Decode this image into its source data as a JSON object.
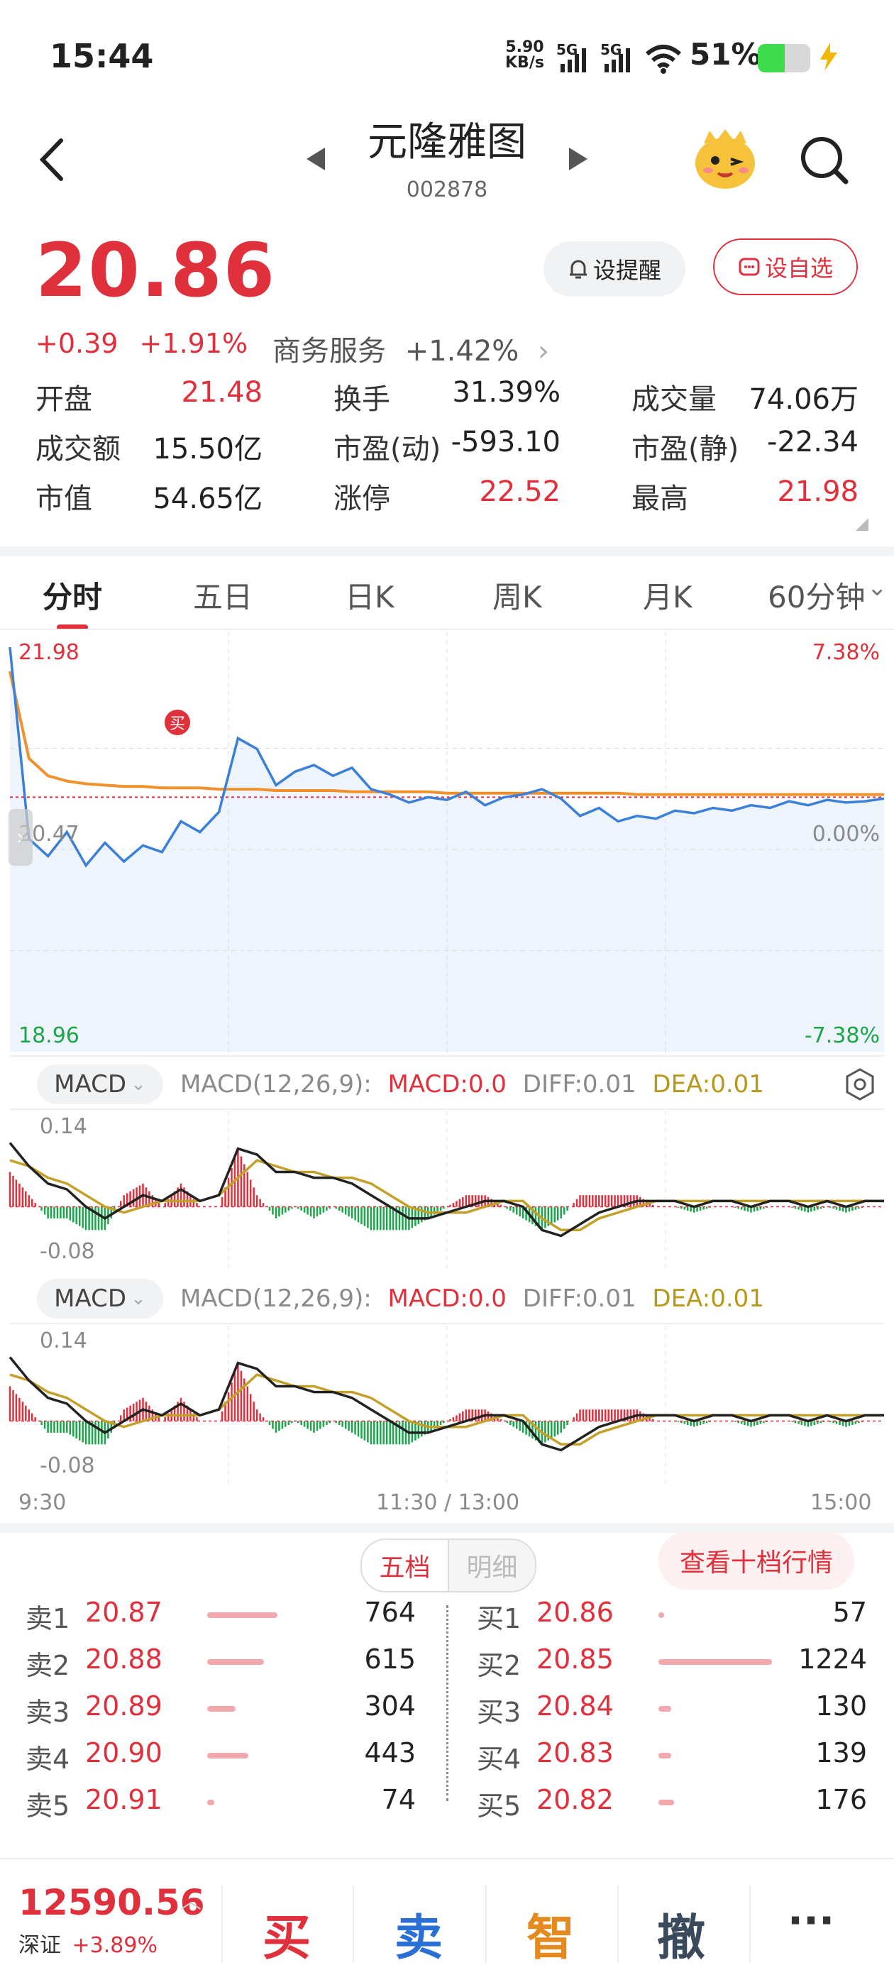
{
  "status": {
    "time": "15:44",
    "net_speed_top": "5.90",
    "net_speed_bottom": "KB/s",
    "sig1": "5G",
    "sig2": "5G",
    "battery": "51%"
  },
  "header": {
    "name": "元隆雅图",
    "code": "002878"
  },
  "quote": {
    "price": "20.86",
    "change": "+0.39",
    "change_pct": "+1.91%",
    "sector": "商务服务",
    "sector_pct": "+1.42%",
    "alert_label": "设提醒",
    "watch_label": "设自选"
  },
  "stats": [
    [
      {
        "label": "开盘",
        "value": "21.48",
        "color": "red"
      },
      {
        "label": "换手",
        "value": "31.39%",
        "color": "dark"
      },
      {
        "label": "成交量",
        "value": "74.06万",
        "color": "dark"
      }
    ],
    [
      {
        "label": "成交额",
        "value": "15.50亿",
        "color": "dark"
      },
      {
        "label": "市盈(动)",
        "value": "-593.10",
        "color": "dark"
      },
      {
        "label": "市盈(静)",
        "value": "-22.34",
        "color": "dark"
      }
    ],
    [
      {
        "label": "市值",
        "value": "54.65亿",
        "color": "dark"
      },
      {
        "label": "涨停",
        "value": "22.52",
        "color": "red"
      },
      {
        "label": "最高",
        "value": "21.98",
        "color": "red"
      }
    ]
  ],
  "tabs": [
    "分时",
    "五日",
    "日K",
    "周K",
    "月K",
    "60分钟"
  ],
  "chart_data": {
    "type": "line",
    "y_top": "21.98",
    "y_mid": "20.47",
    "y_bottom": "18.96",
    "pct_top": "7.38%",
    "pct_mid": "0.00%",
    "pct_bottom": "-7.38%",
    "buy_marker": "买",
    "x_labels": [
      "9:30",
      "11:30 / 13:00",
      "15:00"
    ],
    "price_series": [
      21.98,
      20.55,
      20.42,
      20.6,
      20.35,
      20.52,
      20.38,
      20.5,
      20.45,
      20.68,
      20.6,
      20.75,
      21.3,
      21.22,
      20.95,
      21.05,
      21.1,
      21.02,
      21.08,
      20.92,
      20.88,
      20.82,
      20.86,
      20.84,
      20.9,
      20.8,
      20.86,
      20.88,
      20.92,
      20.85,
      20.72,
      20.78,
      20.68,
      20.72,
      20.7,
      20.76,
      20.74,
      20.78,
      20.76,
      20.8,
      20.78,
      20.83,
      20.8,
      20.84,
      20.82,
      20.83,
      20.85
    ],
    "avg_series": [
      21.8,
      21.15,
      21.02,
      20.98,
      20.96,
      20.95,
      20.94,
      20.94,
      20.93,
      20.93,
      20.93,
      20.92,
      20.92,
      20.92,
      20.91,
      20.91,
      20.91,
      20.91,
      20.9,
      20.9,
      20.9,
      20.9,
      20.9,
      20.89,
      20.89,
      20.89,
      20.89,
      20.89,
      20.89,
      20.89,
      20.89,
      20.89,
      20.89,
      20.88,
      20.88,
      20.88,
      20.88,
      20.88,
      20.88,
      20.88,
      20.88,
      20.88,
      20.88,
      20.88,
      20.88,
      20.88,
      20.88
    ]
  },
  "macd_panels": [
    {
      "name": "MACD",
      "params": "MACD(12,26,9):",
      "macd": "MACD:0.0",
      "diff": "DIFF:0.01",
      "dea": "DEA:0.01",
      "ymax": "0.14",
      "ymin": "-0.08"
    },
    {
      "name": "MACD",
      "params": "MACD(12,26,9):",
      "macd": "MACD:0.0",
      "diff": "DIFF:0.01",
      "dea": "DEA:0.01",
      "ymax": "0.14",
      "ymin": "-0.08"
    }
  ],
  "macd_data": {
    "diff": [
      0.11,
      0.07,
      0.04,
      0.03,
      0.0,
      -0.02,
      0.0,
      0.02,
      0.01,
      0.03,
      0.01,
      0.02,
      0.1,
      0.09,
      0.06,
      0.06,
      0.05,
      0.05,
      0.04,
      0.02,
      0.0,
      -0.02,
      -0.02,
      -0.01,
      0.0,
      0.01,
      0.01,
      0.0,
      -0.04,
      -0.05,
      -0.03,
      -0.01,
      0.0,
      0.01,
      0.01,
      0.01,
      0.0,
      0.01,
      0.01,
      0.0,
      0.01,
      0.01,
      0.0,
      0.01,
      0.0,
      0.01,
      0.01
    ],
    "dea": [
      0.08,
      0.07,
      0.05,
      0.04,
      0.02,
      0.0,
      -0.01,
      0.0,
      0.01,
      0.01,
      0.01,
      0.02,
      0.05,
      0.08,
      0.07,
      0.06,
      0.06,
      0.05,
      0.05,
      0.04,
      0.02,
      0.0,
      -0.01,
      -0.01,
      -0.01,
      0.0,
      0.01,
      0.01,
      -0.02,
      -0.04,
      -0.04,
      -0.02,
      -0.01,
      0.0,
      0.01,
      0.01,
      0.01,
      0.01,
      0.01,
      0.01,
      0.01,
      0.01,
      0.01,
      0.01,
      0.01,
      0.01,
      0.01
    ],
    "hist": [
      0.06,
      0.02,
      -0.02,
      -0.02,
      -0.04,
      -0.04,
      0.02,
      0.04,
      0.0,
      0.04,
      0.0,
      0.0,
      0.1,
      0.02,
      -0.02,
      0.0,
      -0.02,
      0.0,
      -0.02,
      -0.04,
      -0.04,
      -0.04,
      -0.02,
      0.0,
      0.02,
      0.02,
      0.0,
      -0.02,
      -0.04,
      -0.02,
      0.02,
      0.02,
      0.02,
      0.02,
      0.0,
      0.0,
      -0.01,
      0.0,
      0.0,
      -0.01,
      0.0,
      0.0,
      -0.01,
      0.0,
      -0.01,
      0.0,
      0.0
    ]
  },
  "orderbook": {
    "tab_active": "五档",
    "tab_other": "明细",
    "ten_levels": "查看十档行情",
    "sell": [
      {
        "label": "卖1",
        "price": "20.87",
        "vol": "764",
        "bar": 0.62
      },
      {
        "label": "卖2",
        "price": "20.88",
        "vol": "615",
        "bar": 0.5
      },
      {
        "label": "卖3",
        "price": "20.89",
        "vol": "304",
        "bar": 0.25
      },
      {
        "label": "卖4",
        "price": "20.90",
        "vol": "443",
        "bar": 0.36
      },
      {
        "label": "卖5",
        "price": "20.91",
        "vol": "74",
        "bar": 0.06
      }
    ],
    "buy": [
      {
        "label": "买1",
        "price": "20.86",
        "vol": "57",
        "bar": 0.05
      },
      {
        "label": "买2",
        "price": "20.85",
        "vol": "1224",
        "bar": 1.0
      },
      {
        "label": "买3",
        "price": "20.84",
        "vol": "130",
        "bar": 0.11
      },
      {
        "label": "买4",
        "price": "20.83",
        "vol": "139",
        "bar": 0.11
      },
      {
        "label": "买5",
        "price": "20.82",
        "vol": "176",
        "bar": 0.14
      }
    ]
  },
  "footer": {
    "index_value": "12590.56",
    "index_name": "深证",
    "index_pct": "+3.89%",
    "buy": "买",
    "sell": "卖",
    "smart": "智",
    "cancel": "撤",
    "more": "···"
  }
}
